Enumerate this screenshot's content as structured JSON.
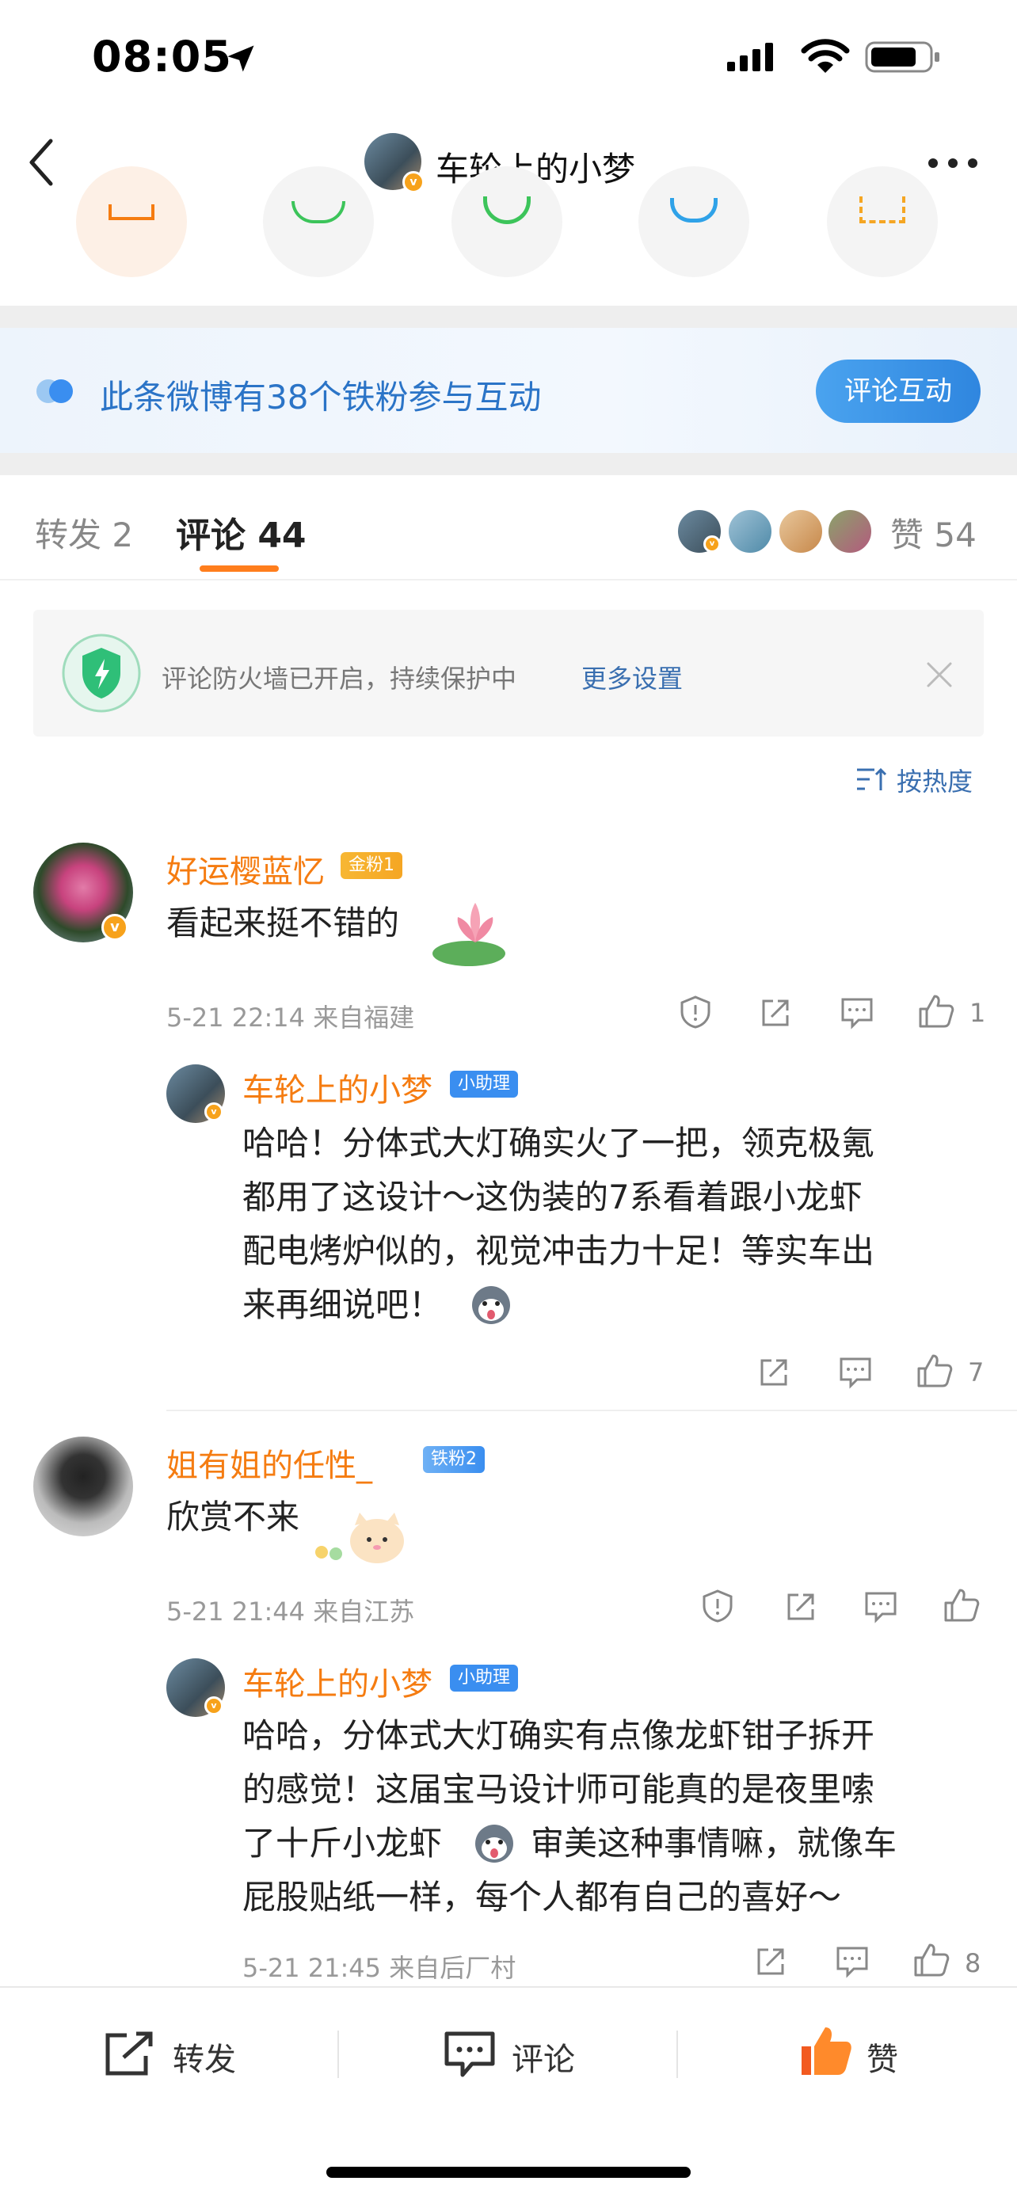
{
  "status_bar": {
    "time": "08:05"
  },
  "header": {
    "title": "车轮上的小梦",
    "back_icon": "back-arrow-icon",
    "more_icon": "more-dots-icon"
  },
  "banner": {
    "text": "此条微博有38个铁粉参与互动",
    "button": "评论互动"
  },
  "tabs": {
    "repost": "转发 2",
    "comment": "评论 44",
    "like": "赞 54"
  },
  "firewall": {
    "text": "评论防火墙已开启，持续保护中",
    "link": "更多设置"
  },
  "sort": {
    "label": "按热度"
  },
  "comments": [
    {
      "user": "好运樱蓝忆",
      "badge": "金粉1",
      "text": "看起来挺不错的",
      "meta": "5-21 22:14  来自福建",
      "likes": "1",
      "reply": {
        "user": "车轮上的小梦",
        "badge": "小助理",
        "lines": [
          "哈哈！分体式大灯确实火了一把，领克极氪",
          "都用了这设计～这伪装的7系看着跟小龙虾",
          "配电烤炉似的，视觉冲击力十足！等实车出",
          "来再细说吧！"
        ],
        "likes": "7"
      }
    },
    {
      "user": "姐有姐的任性_",
      "badge": "铁粉2",
      "text": "欣赏不来",
      "meta": "5-21 21:44  来自江苏",
      "likes": "",
      "reply": {
        "user": "车轮上的小梦",
        "badge": "小助理",
        "lines": [
          "哈哈，分体式大灯确实有点像龙虾钳子拆开",
          "的感觉！这届宝马设计师可能真的是夜里嗦",
          "了十斤小龙虾",
          "审美这种事情嘛，就像车",
          "屁股贴纸一样，每个人都有自己的喜好～"
        ],
        "meta": "5-21 21:45  来自后厂村",
        "likes": "8"
      }
    }
  ],
  "bottom_bar": {
    "repost": "转发",
    "comment": "评论",
    "like": "赞"
  },
  "colors": {
    "accent": "#f57c11",
    "link": "#3a6fb0",
    "banner_button": "#2f86df"
  }
}
